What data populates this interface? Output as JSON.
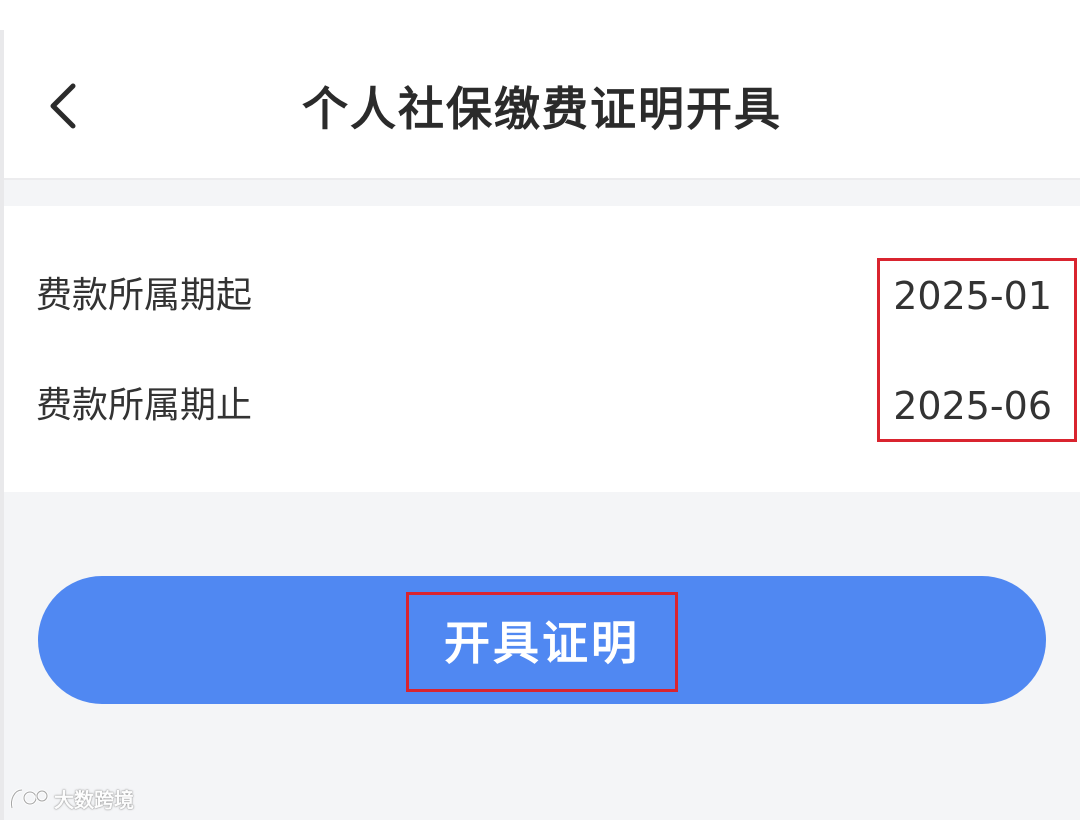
{
  "header": {
    "title": "个人社保缴费证明开具",
    "back_icon": "chevron-left-icon"
  },
  "form": {
    "rows": [
      {
        "label": "费款所属期起",
        "value": "2025-01"
      },
      {
        "label": "费款所属期止",
        "value": "2025-06"
      }
    ]
  },
  "action": {
    "issue_label": "开具证明"
  },
  "watermark": {
    "text": "大数跨境"
  },
  "colors": {
    "primary_button": "#5088f2",
    "highlight": "#d9242f",
    "background": "#f4f5f7",
    "text": "#333333"
  }
}
